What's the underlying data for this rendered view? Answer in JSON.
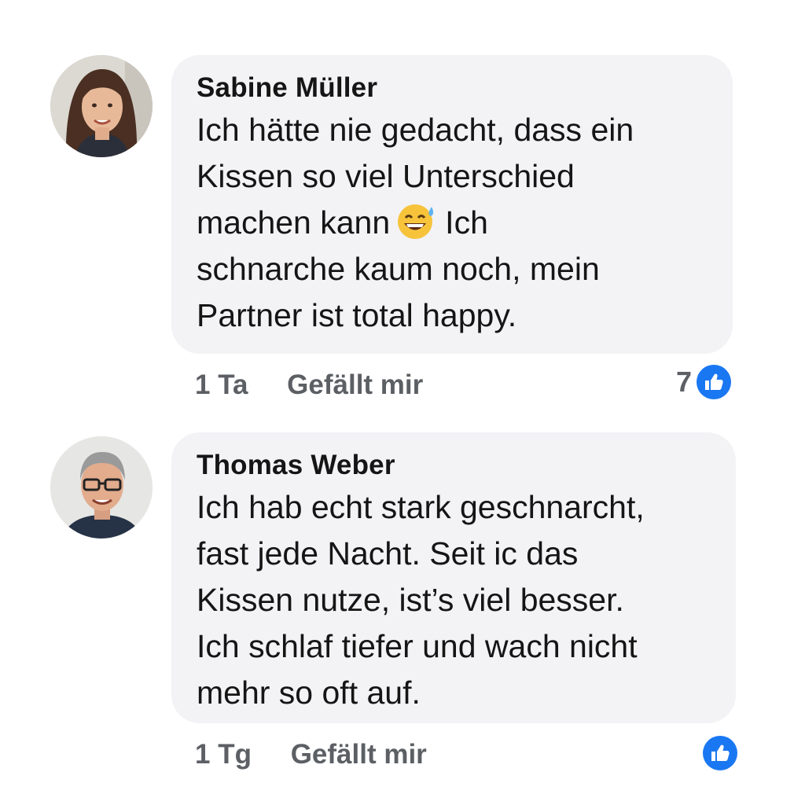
{
  "comments": [
    {
      "author": "Sabine Müller",
      "lines": [
        "Ich hätte nie gedacht, dass ein",
        "Kissen so viel Unterschied",
        "machen kann",
        "Ich",
        "schnarche kaum noch, mein",
        "Partner ist total happy."
      ],
      "emoji": "sweat-smile-emoji",
      "time": "1 Ta",
      "like_label": "Gefällt mir",
      "reaction_count": "7",
      "reaction_icon": "thumbs-up-icon"
    },
    {
      "author": "Thomas Weber",
      "lines": [
        "Ich hab echt stark geschnarcht,",
        "fast jede Nacht. Seit ic das",
        "Kissen nutze, ist’s viel besser.",
        "Ich schlaf tiefer und wach nicht",
        "mehr so oft auf."
      ],
      "time": "1 Tg",
      "like_label": "Gefällt mir",
      "reaction_count": "",
      "reaction_icon": "thumbs-up-icon"
    }
  ],
  "colors": {
    "bubble": "#f3f3f6",
    "meta_text": "#5c5f64",
    "like_blue": "#1a77f2"
  }
}
